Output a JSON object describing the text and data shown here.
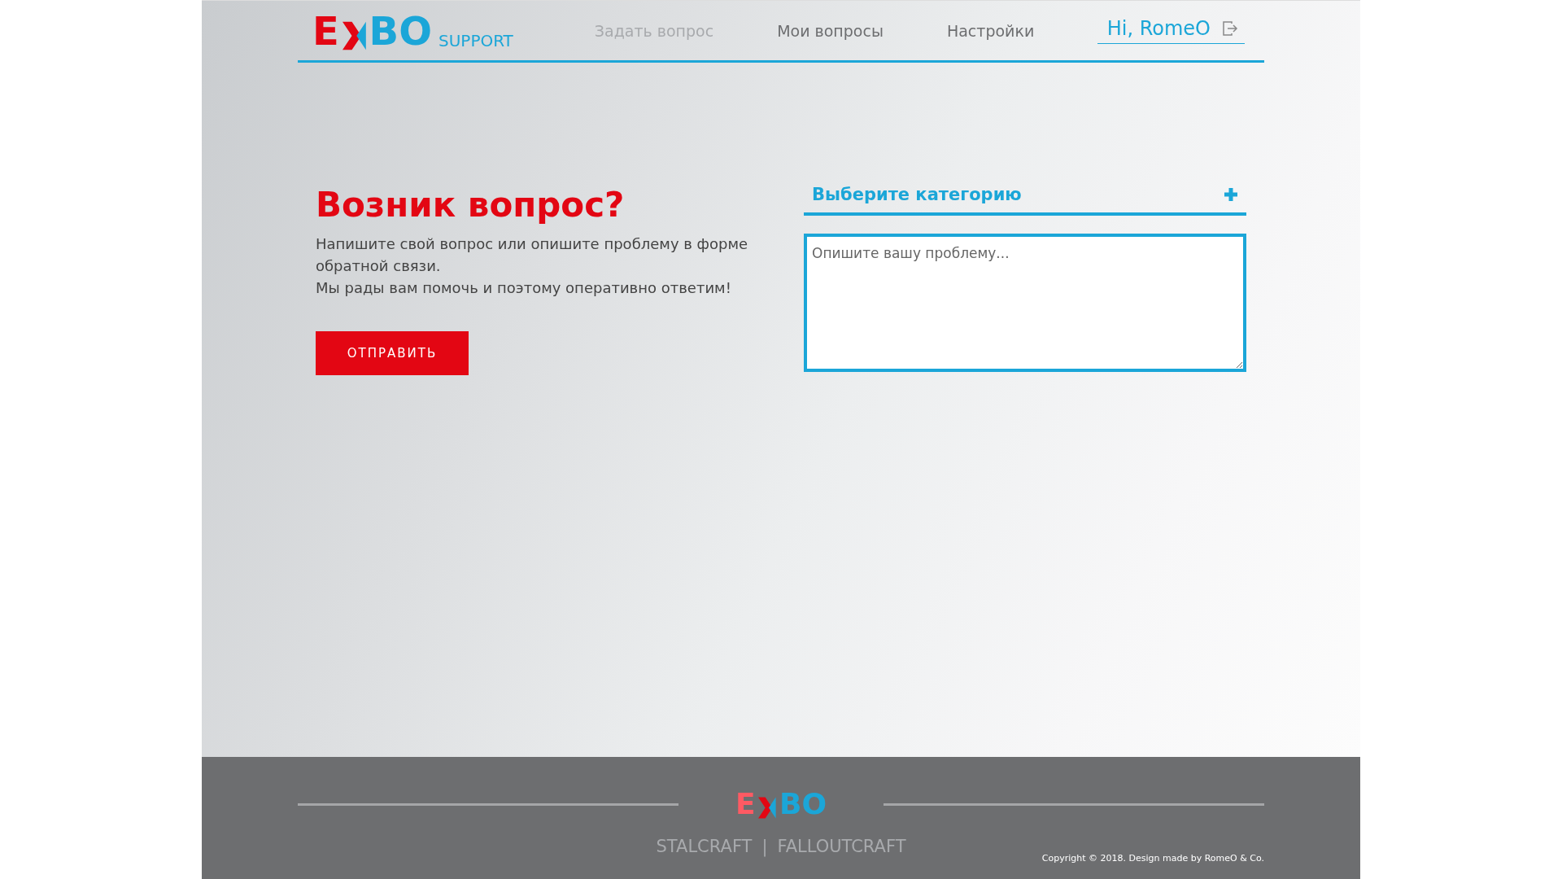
{
  "header": {
    "logo": {
      "left": "E",
      "right": "BO",
      "sub": "SUPPORT"
    },
    "nav": [
      {
        "label": "Задать вопрос",
        "selected": true
      },
      {
        "label": "Мои вопросы",
        "selected": false
      },
      {
        "label": "Настройки",
        "selected": false
      }
    ],
    "user": "Hi, RomeO"
  },
  "intro": {
    "title": "Возник вопрос?",
    "text": [
      "Напишите свой вопрос или опишите проблему в форме обратной связи.",
      "Мы рады вам помочь и поэтому оперативно ответим!"
    ],
    "button": "ОТПРАВИТЬ"
  },
  "form": {
    "category": "Выберите категорию",
    "placeholder": "Опишите вашу проблему..."
  },
  "footer": {
    "logo": {
      "left": "E",
      "right": "BO"
    },
    "links": [
      "STALCRAFT",
      "FALLOUTCRAFT"
    ],
    "separator": "|",
    "copyright": "Copyright © 2018. Design made by RomeO & Co."
  }
}
